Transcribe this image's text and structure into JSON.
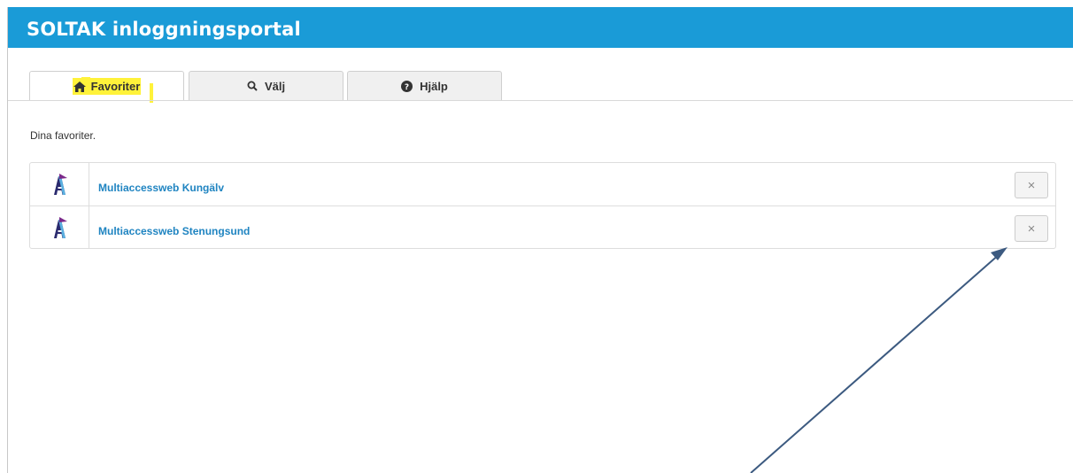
{
  "header": {
    "title": "SOLTAK inloggningsportal",
    "color": "#1a9bd7"
  },
  "tabs": [
    {
      "label": "Favoriter",
      "icon": "home-icon",
      "active": true
    },
    {
      "label": "Välj",
      "icon": "search-icon",
      "active": false
    },
    {
      "label": "Hjälp",
      "icon": "question-circle-icon",
      "active": false
    }
  ],
  "favorites": {
    "intro": "Dina favoriter.",
    "items": [
      {
        "name": "Multiaccessweb Kungälv",
        "logo": "multiaccess-logo",
        "remove": "×"
      },
      {
        "name": "Multiaccessweb Stenungsund",
        "logo": "multiaccess-logo",
        "remove": "×"
      }
    ]
  },
  "annotation": {
    "highlight_color": "#fff23a",
    "arrow_color": "#3c5a80"
  }
}
